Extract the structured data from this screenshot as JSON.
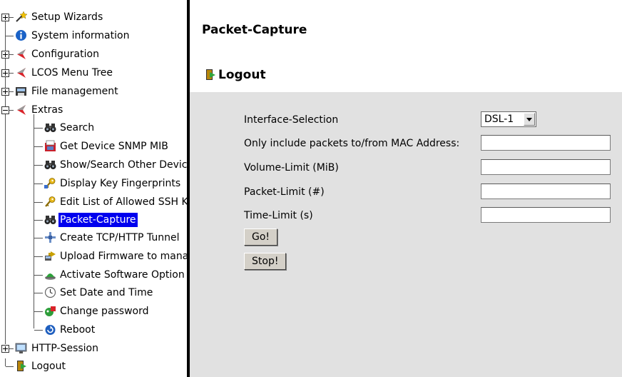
{
  "tree": {
    "items": [
      {
        "label": "Setup Wizards",
        "icon": "wizard-icon"
      },
      {
        "label": "System information",
        "icon": "info-icon"
      },
      {
        "label": "Configuration",
        "icon": "config-icon"
      },
      {
        "label": "LCOS Menu Tree",
        "icon": "menu-tree-icon"
      },
      {
        "label": "File management",
        "icon": "file-management-icon"
      },
      {
        "label": "Extras",
        "icon": "extras-icon"
      },
      {
        "label": "Search",
        "icon": "binoculars-icon"
      },
      {
        "label": "Get Device SNMP MIB",
        "icon": "snmp-mib-icon"
      },
      {
        "label": "Show/Search Other Devices",
        "icon": "binoculars-icon"
      },
      {
        "label": "Display Key Fingerprints",
        "icon": "key-icon"
      },
      {
        "label": "Edit List of Allowed SSH Keys",
        "icon": "edit-key-icon"
      },
      {
        "label": "Packet-Capture",
        "icon": "binoculars-icon"
      },
      {
        "label": "Create TCP/HTTP Tunnel",
        "icon": "tunnel-icon"
      },
      {
        "label": "Upload Firmware to managed Devices",
        "icon": "upload-firmware-icon"
      },
      {
        "label": "Activate Software Option",
        "icon": "software-option-icon"
      },
      {
        "label": "Set Date and Time",
        "icon": "clock-icon"
      },
      {
        "label": "Change password",
        "icon": "password-icon"
      },
      {
        "label": "Reboot",
        "icon": "reboot-icon"
      },
      {
        "label": "HTTP-Session",
        "icon": "http-session-icon"
      },
      {
        "label": "Logout",
        "icon": "logout-icon"
      }
    ],
    "selected": "Packet-Capture"
  },
  "content": {
    "title": "Packet-Capture",
    "logout_label": "Logout",
    "form": {
      "interface_label": "Interface-Selection",
      "interface_value": "DSL-1",
      "mac_label": "Only include packets to/from MAC Address:",
      "mac_value": "",
      "volume_label": "Volume-Limit (MiB)",
      "volume_value": "",
      "packet_label": "Packet-Limit (#)",
      "packet_value": "",
      "time_label": "Time-Limit (s)",
      "time_value": "",
      "go_label": "Go!",
      "stop_label": "Stop!"
    }
  },
  "colors": {
    "selection": "#0000ee",
    "panel": "#e1e1e1",
    "divider": "#000000"
  }
}
